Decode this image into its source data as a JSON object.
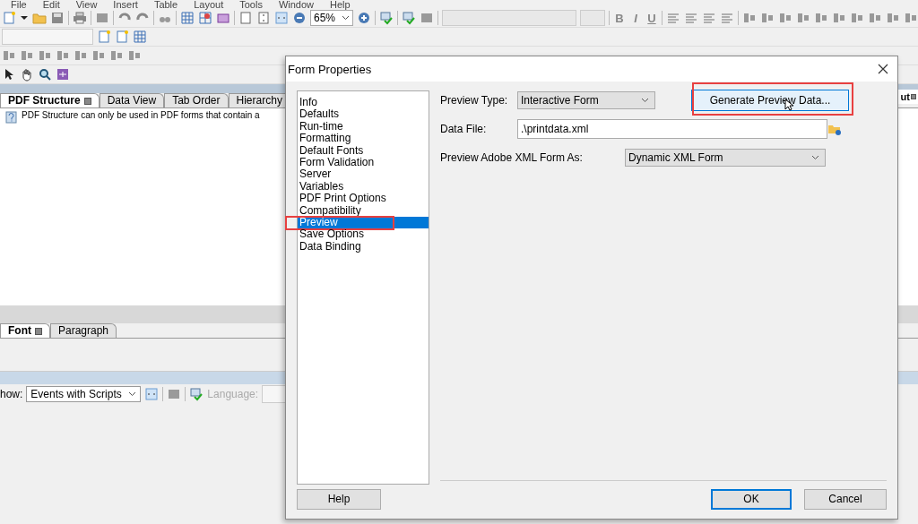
{
  "menu_bar": [
    "File",
    "Edit",
    "View",
    "Insert",
    "Table",
    "Layout",
    "Tools",
    "Window",
    "Help"
  ],
  "toolbar": {
    "zoom": "65%",
    "format_buttons": [
      "B",
      "I",
      "U"
    ]
  },
  "upper_panel": {
    "tabs": [
      {
        "label": "PDF Structure",
        "selected": true
      },
      {
        "label": "Data View",
        "selected": false
      },
      {
        "label": "Tab Order",
        "selected": false
      },
      {
        "label": "Hierarchy",
        "selected": false
      }
    ],
    "message": "PDF Structure can only be used in PDF forms that contain a"
  },
  "right_panel_tab": {
    "label": "ut"
  },
  "lower_panel": {
    "tabs": [
      {
        "label": "Font",
        "selected": true
      },
      {
        "label": "Paragraph",
        "selected": false
      }
    ]
  },
  "script_bar": {
    "show_label": "how:",
    "show_value": "Events with Scripts",
    "language_label": "Language:",
    "language_disabled": true
  },
  "dialog": {
    "title": "Form Properties",
    "categories": [
      {
        "label": "Info",
        "selected": false,
        "highlighted": false
      },
      {
        "label": "Defaults",
        "selected": false,
        "highlighted": false
      },
      {
        "label": "Run-time",
        "selected": false,
        "highlighted": false
      },
      {
        "label": "Formatting",
        "selected": false,
        "highlighted": false
      },
      {
        "label": "Default Fonts",
        "selected": false,
        "highlighted": false
      },
      {
        "label": "Form Validation",
        "selected": false,
        "highlighted": false
      },
      {
        "label": "Server",
        "selected": false,
        "highlighted": false
      },
      {
        "label": "Variables",
        "selected": false,
        "highlighted": false
      },
      {
        "label": "PDF Print Options",
        "selected": false,
        "highlighted": false
      },
      {
        "label": "Compatibility",
        "selected": false,
        "highlighted": false
      },
      {
        "label": "Preview",
        "selected": true,
        "highlighted": true
      },
      {
        "label": "Save Options",
        "selected": false,
        "highlighted": false
      },
      {
        "label": "Data Binding",
        "selected": false,
        "highlighted": false
      }
    ],
    "preview_type": {
      "label": "Preview Type:",
      "value": "Interactive Form"
    },
    "generate_button": {
      "label": "Generate Preview Data...",
      "highlighted": true
    },
    "data_file": {
      "label": "Data File:",
      "value": ".\\printdata.xml"
    },
    "preview_as": {
      "label": "Preview Adobe XML Form As:",
      "value": "Dynamic XML Form"
    },
    "buttons": [
      {
        "label": "Help",
        "default": false
      },
      {
        "label": "OK",
        "default": true
      },
      {
        "label": "Cancel",
        "default": false
      }
    ]
  }
}
